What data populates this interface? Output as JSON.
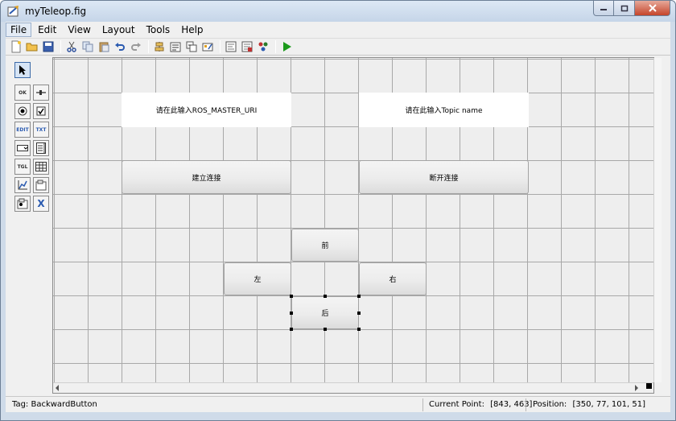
{
  "window": {
    "title": "myTeleop.fig"
  },
  "menubar": {
    "items": [
      "File",
      "Edit",
      "View",
      "Layout",
      "Tools",
      "Help"
    ]
  },
  "toolbar": {
    "buttons": [
      "new-file",
      "open-folder",
      "save",
      "cut",
      "copy",
      "paste",
      "undo",
      "redo",
      "align",
      "menu-editor",
      "tab-order",
      "toolbar-editor",
      "m-file-editor",
      "property-inspector",
      "object-browser",
      "run"
    ]
  },
  "palette": {
    "tools": [
      {
        "name": "select-arrow-icon",
        "label": ""
      },
      {
        "name": "push-button-tool",
        "label": "OK"
      },
      {
        "name": "slider-tool",
        "label": ""
      },
      {
        "name": "radio-button-tool",
        "label": ""
      },
      {
        "name": "checkbox-tool",
        "label": ""
      },
      {
        "name": "edit-text-tool",
        "label": "EDIT"
      },
      {
        "name": "static-text-tool",
        "label": "TXT"
      },
      {
        "name": "popup-menu-tool",
        "label": ""
      },
      {
        "name": "listbox-tool",
        "label": ""
      },
      {
        "name": "toggle-button-tool",
        "label": "TGL"
      },
      {
        "name": "table-tool",
        "label": ""
      },
      {
        "name": "axes-tool",
        "label": ""
      },
      {
        "name": "panel-tool",
        "label": ""
      },
      {
        "name": "button-group-tool",
        "label": ""
      },
      {
        "name": "activex-tool",
        "label": "X"
      }
    ]
  },
  "canvas": {
    "edit_master_uri": "请在此输入ROS_MASTER_URI",
    "edit_topic_name": "请在此输入Topic name",
    "connect_button": "建立连接",
    "disconnect_button": "断开连接",
    "forward_button": "前",
    "left_button": "左",
    "right_button": "右",
    "backward_button": "后"
  },
  "status": {
    "tag": "Tag: BackwardButton",
    "current_point_label": "Current Point:",
    "current_point_value": "[843, 463]",
    "position_label": "Position:",
    "position_value": "[350, 77, 101, 51]"
  },
  "colors": {
    "title_gradient_top": "#dde8f5",
    "close_button": "#c5452b",
    "grid_line": "#a8a8a8",
    "canvas_bg": "#eeeeee",
    "run_arrow": "#1c9a1c"
  }
}
